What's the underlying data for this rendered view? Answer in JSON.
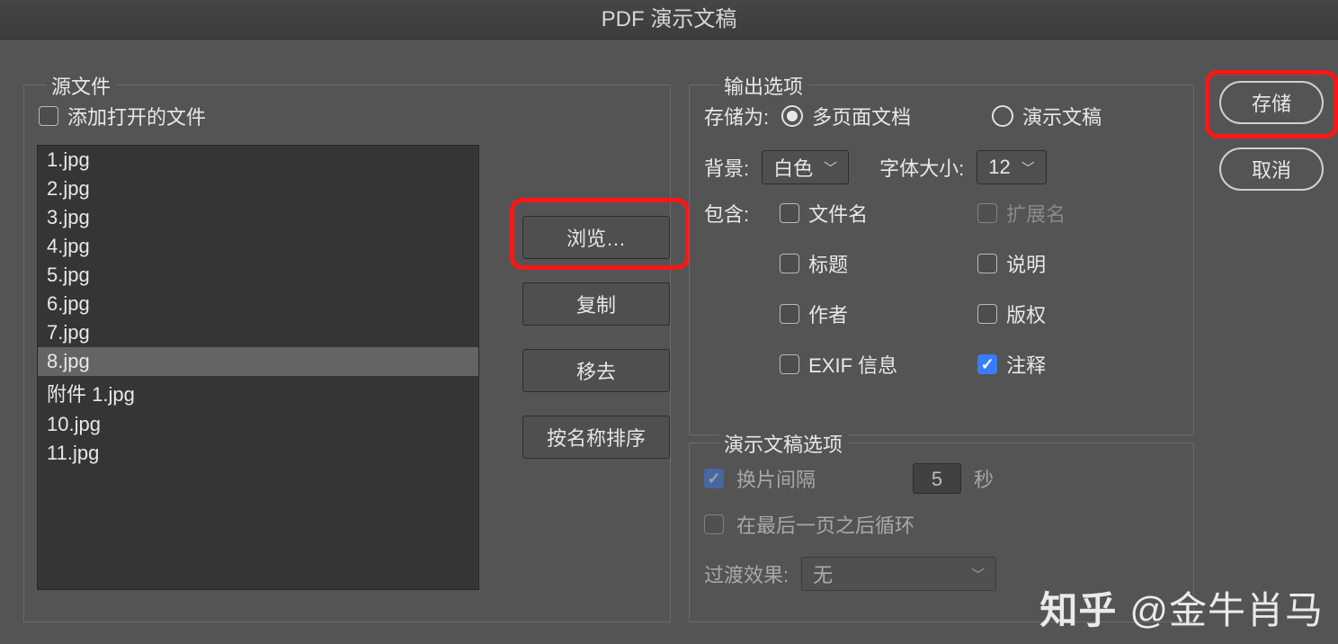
{
  "title": "PDF 演示文稿",
  "sourceFiles": {
    "legend": "源文件",
    "addOpenFiles": "添加打开的文件",
    "files": [
      "1.jpg",
      "2.jpg",
      "3.jpg",
      "4.jpg",
      "5.jpg",
      "6.jpg",
      "7.jpg",
      "8.jpg",
      "附件 1.jpg",
      "10.jpg",
      "11.jpg"
    ],
    "selectedIndex": 7,
    "buttons": {
      "browse": "浏览…",
      "copy": "复制",
      "remove": "移去",
      "sortByName": "按名称排序"
    }
  },
  "outputOptions": {
    "legend": "输出选项",
    "saveAsLabel": "存储为:",
    "radios": {
      "multiPage": "多页面文档",
      "presentation": "演示文稿",
      "selected": "multiPage"
    },
    "backgroundLabel": "背景:",
    "backgroundValue": "白色",
    "fontSizeLabel": "字体大小:",
    "fontSizeValue": "12",
    "includeLabel": "包含:",
    "include": {
      "filename": {
        "label": "文件名",
        "checked": false,
        "enabled": true
      },
      "extension": {
        "label": "扩展名",
        "checked": false,
        "enabled": false
      },
      "title": {
        "label": "标题",
        "checked": false,
        "enabled": true
      },
      "desc": {
        "label": "说明",
        "checked": false,
        "enabled": true
      },
      "author": {
        "label": "作者",
        "checked": false,
        "enabled": true
      },
      "copyright": {
        "label": "版权",
        "checked": false,
        "enabled": true
      },
      "exif": {
        "label": "EXIF 信息",
        "checked": false,
        "enabled": true
      },
      "notes": {
        "label": "注释",
        "checked": true,
        "enabled": true
      }
    }
  },
  "presentationOptions": {
    "legend": "演示文稿选项",
    "interval": {
      "label": "换片间隔",
      "value": "5",
      "unit": "秒",
      "checked": true,
      "enabled": false
    },
    "loop": {
      "label": "在最后一页之后循环",
      "checked": false,
      "enabled": false
    },
    "transitionLabel": "过渡效果:",
    "transitionValue": "无",
    "transitionEnabled": false
  },
  "actions": {
    "save": "存储",
    "cancel": "取消"
  },
  "watermark": {
    "logo": "知乎",
    "text": "@金牛肖马"
  }
}
